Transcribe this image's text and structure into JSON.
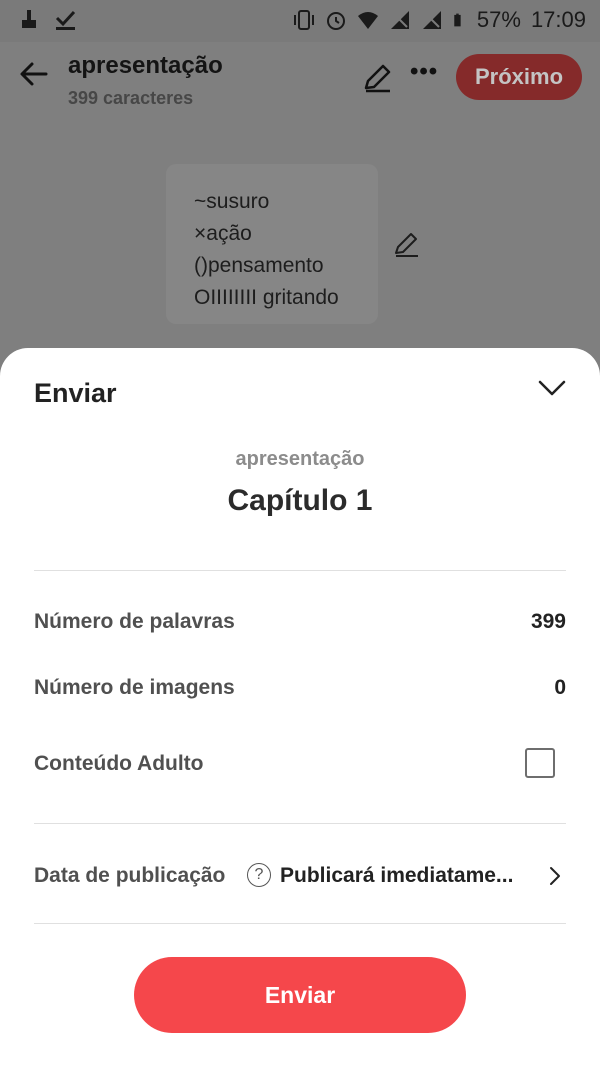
{
  "status_bar": {
    "battery": "57%",
    "time": "17:09"
  },
  "header": {
    "title": "apresentação",
    "subtitle": "399 caracteres",
    "next_label": "Próximo"
  },
  "note": {
    "lines": [
      "~susuro",
      "×ação",
      "()pensamento",
      "OIIIIIIII gritando"
    ]
  },
  "sheet": {
    "title": "Enviar",
    "work_name": "apresentação",
    "chapter": "Capítulo 1",
    "rows": {
      "word_count": {
        "label": "Número de palavras",
        "value": "399"
      },
      "image_count": {
        "label": "Número de imagens",
        "value": "0"
      },
      "adult": {
        "label": "Conteúdo Adulto",
        "checked": false
      }
    },
    "publish": {
      "label": "Data de publicação",
      "help": "?",
      "value": "Publicará imediatame..."
    },
    "send_label": "Enviar"
  },
  "colors": {
    "accent": "#f5474b",
    "dim_accent": "#852a2a",
    "overlay": "#7f7f7f"
  }
}
